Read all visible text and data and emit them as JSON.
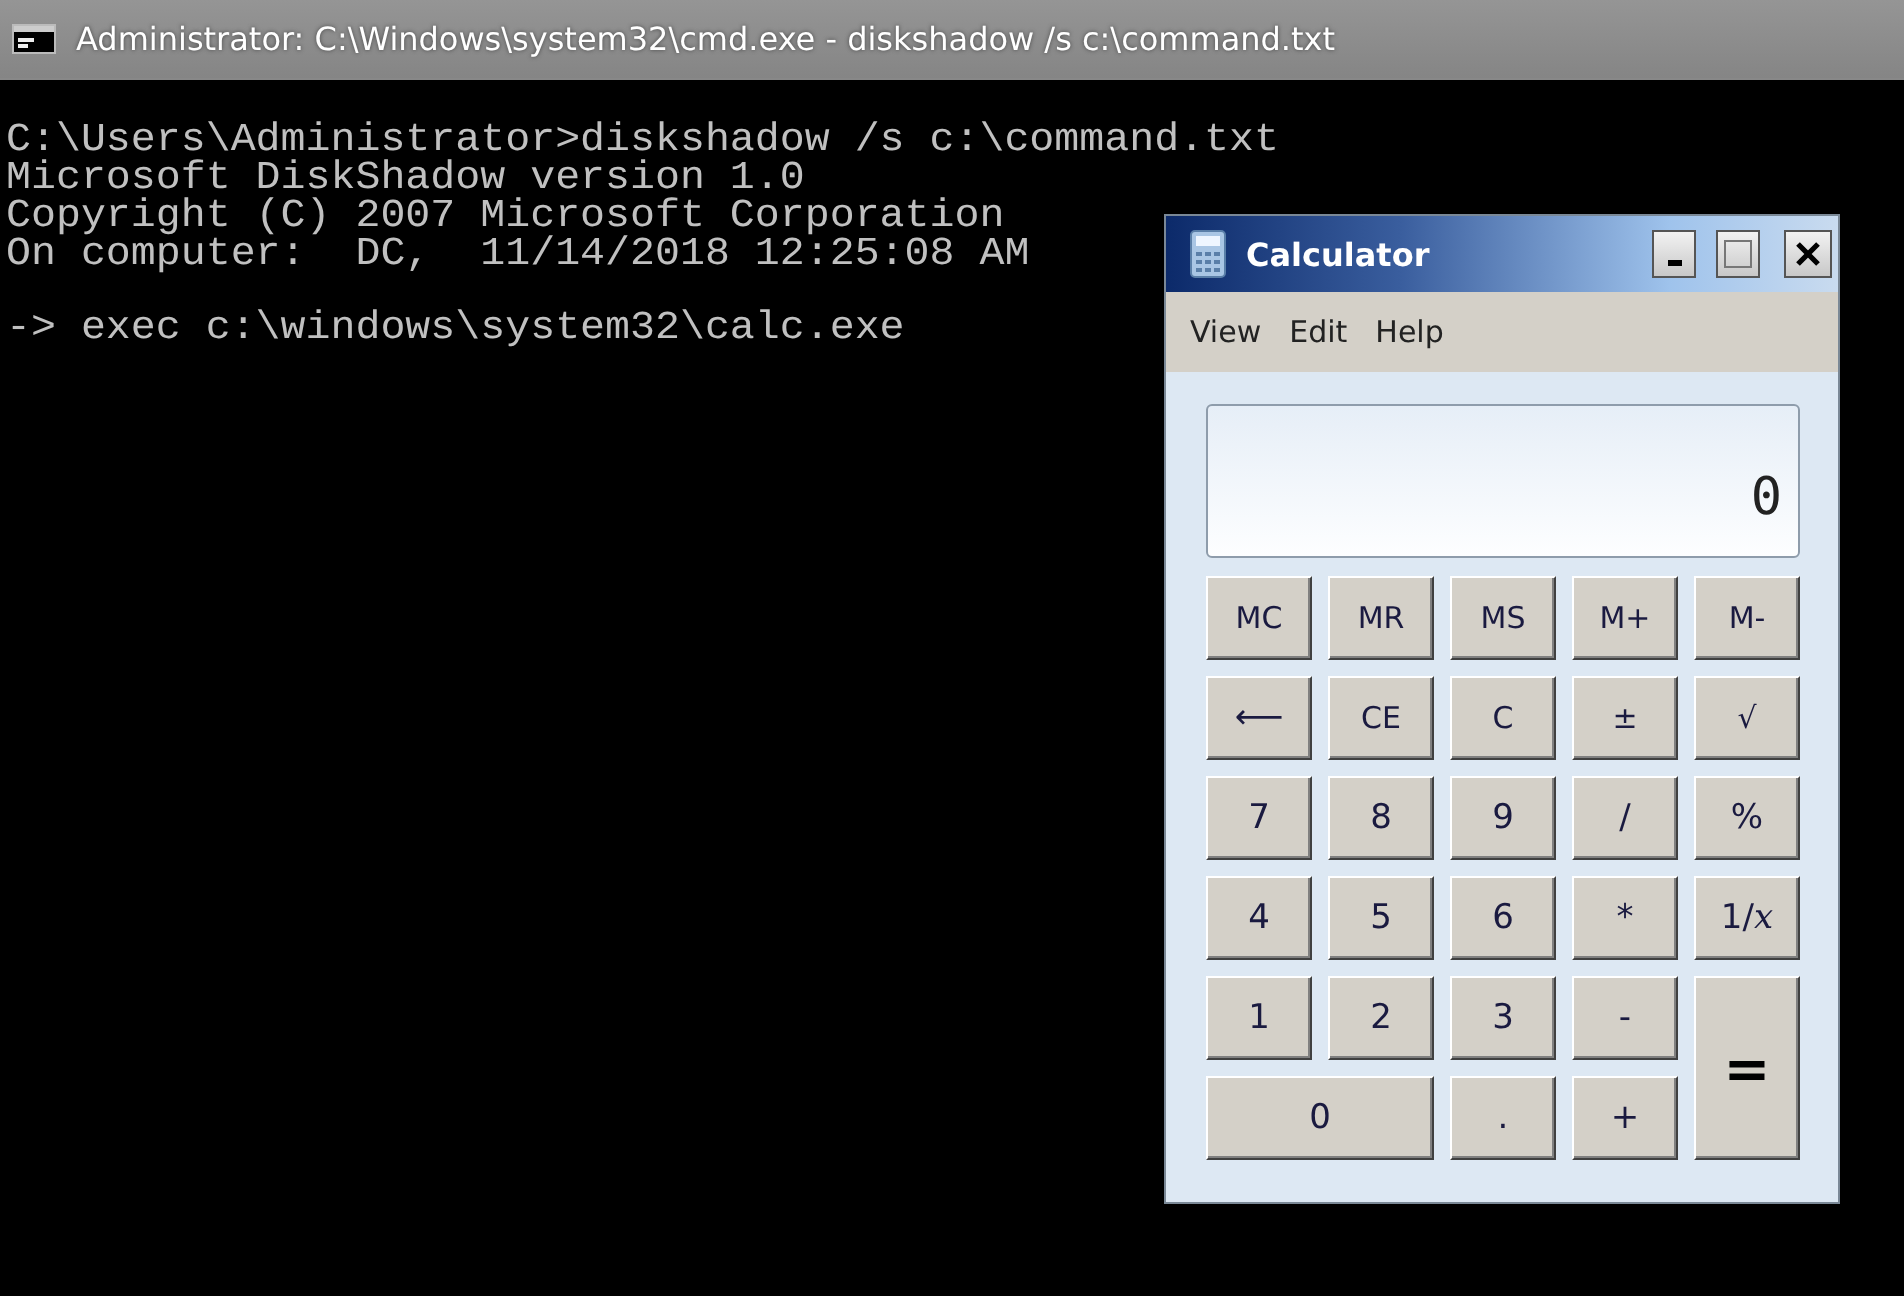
{
  "console_window": {
    "title": "Administrator: C:\\Windows\\system32\\cmd.exe - diskshadow  /s c:\\command.txt",
    "blocks": [
      {
        "lines": [
          "C:\\Users\\Administrator>diskshadow /s c:\\command.txt",
          "Microsoft DiskShadow version 1.0",
          "Copyright (C) 2007 Microsoft Corporation",
          "On computer:  DC,  11/14/2018 12:25:08 AM"
        ]
      },
      {
        "lines": [
          "-> exec c:\\windows\\system32\\calc.exe"
        ]
      }
    ]
  },
  "calculator": {
    "title": "Calculator",
    "menu": [
      "View",
      "Edit",
      "Help"
    ],
    "display": "0",
    "keys": [
      {
        "label": "MC",
        "kind": "key"
      },
      {
        "label": "MR",
        "kind": "key"
      },
      {
        "label": "MS",
        "kind": "key"
      },
      {
        "label": "M+",
        "kind": "key"
      },
      {
        "label": "M-",
        "kind": "key"
      },
      {
        "label": "⟵",
        "kind": "key"
      },
      {
        "label": "CE",
        "kind": "key"
      },
      {
        "label": "C",
        "kind": "key"
      },
      {
        "label": "±",
        "kind": "key"
      },
      {
        "label": "√",
        "kind": "key"
      },
      {
        "label": "7",
        "kind": "key"
      },
      {
        "label": "8",
        "kind": "key"
      },
      {
        "label": "9",
        "kind": "key"
      },
      {
        "label": "/",
        "kind": "key"
      },
      {
        "label": "%",
        "kind": "key"
      },
      {
        "label": "4",
        "kind": "key"
      },
      {
        "label": "5",
        "kind": "key"
      },
      {
        "label": "6",
        "kind": "key"
      },
      {
        "label": "*",
        "kind": "key"
      },
      {
        "label": "1/*x*",
        "kind": "key"
      },
      {
        "label": "1",
        "kind": "key"
      },
      {
        "label": "2",
        "kind": "key"
      },
      {
        "label": "3",
        "kind": "key"
      },
      {
        "label": "-",
        "kind": "key"
      },
      {
        "label": "=",
        "kind": "tall"
      },
      {
        "label": "0",
        "kind": "wide"
      },
      {
        "label": ".",
        "kind": "key"
      },
      {
        "label": "+",
        "kind": "key"
      }
    ]
  }
}
